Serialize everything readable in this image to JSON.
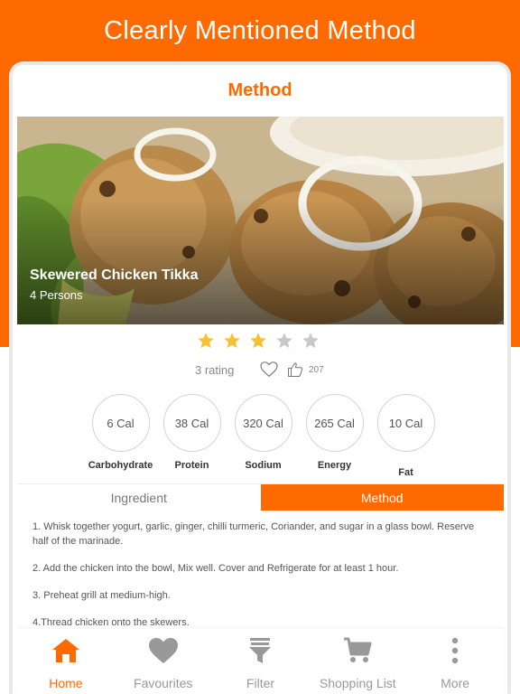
{
  "promo": {
    "title": "Clearly Mentioned Method"
  },
  "header": {
    "title": "Method"
  },
  "recipe": {
    "title": "Skewered Chicken Tikka",
    "servings": "4 Persons",
    "rating_value": 3,
    "rating_max": 5,
    "rating_text": "3 rating",
    "likes": "207"
  },
  "nutrients": [
    {
      "value": "6 Cal",
      "label": "Carbohydrate"
    },
    {
      "value": "38 Cal",
      "label": "Protein"
    },
    {
      "value": "320 Cal",
      "label": "Sodium"
    },
    {
      "value": "265 Cal",
      "label": "Energy"
    },
    {
      "value": "10 Cal",
      "label": "Fat"
    }
  ],
  "tabs": [
    {
      "label": "Ingredient",
      "active": false
    },
    {
      "label": "Method",
      "active": true
    }
  ],
  "steps": [
    "1. Whisk together yogurt, garlic, ginger, chilli turmeric, Coriander, and  sugar in a glass bowl. Reserve half of the marinade.",
    "2. Add the chicken into the bowl, Mix well. Cover and Refrigerate for at least 1 hour.",
    "3. Preheat grill at medium-high.",
    "4.Thread chicken onto the skewers."
  ],
  "nav": [
    {
      "label": "Home",
      "icon": "home-icon",
      "active": true
    },
    {
      "label": "Favourites",
      "icon": "heart-icon",
      "active": false
    },
    {
      "label": "Filter",
      "icon": "filter-icon",
      "active": false
    },
    {
      "label": "Shopping List",
      "icon": "cart-icon",
      "active": false
    },
    {
      "label": "More",
      "icon": "more-vertical-icon",
      "active": false
    }
  ],
  "colors": {
    "accent": "#FF6A00",
    "star_filled": "#F6C234",
    "star_empty": "#C8C8C8",
    "nav_inactive": "#999999"
  }
}
